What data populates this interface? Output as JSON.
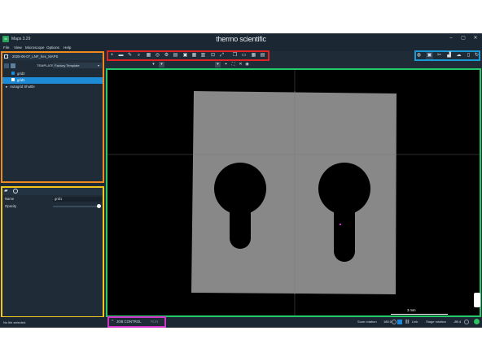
{
  "window": {
    "app_icon": "app-logo-icon",
    "title": "Maps 3.29",
    "brand": "thermo scientific",
    "controls": [
      "minimize-icon",
      "maximize-icon",
      "close-icon"
    ]
  },
  "menu": [
    "File",
    "View",
    "Microscope",
    "Options",
    "Help"
  ],
  "project_panel": {
    "document_title": "2025-06-07_LNF_hex_MAPS",
    "template_label": "TEMPLATE",
    "template_value": "Factory Template",
    "tree": [
      {
        "label": "grid2",
        "selected": false
      },
      {
        "label": "grid1",
        "selected": true
      },
      {
        "label": "Autogrid Shuttle",
        "selected": false
      }
    ]
  },
  "properties_panel": {
    "name_label": "Name",
    "name_value": "grid1",
    "opacity_label": "Opacity",
    "opacity": 1.0
  },
  "toolbar_icons": [
    "add-icon",
    "minus-icon",
    "draw-icon",
    "zoom-icon",
    "grid-icon",
    "target-icon",
    "settings-icon",
    "layers-icon",
    "image-icon",
    "tile-icon",
    "align-icon",
    "fit-icon",
    "expand-icon",
    "copy-icon",
    "paste-icon",
    "view-icon",
    "more-icon"
  ],
  "right_toolbar_icons": [
    "globe-icon",
    "camera-icon",
    "tools-icon",
    "chart-icon",
    "cloud-icon",
    "document-icon",
    "refresh-icon"
  ],
  "viewport": {
    "scalebar_label": "3 mm"
  },
  "status": {
    "selection_text": "No tile selected",
    "job_control_label": "JOB CONTROL",
    "run_label": "RUN",
    "scan_rotation_label": "Scan rotation",
    "scan_rotation_value": "180.0",
    "link_label": "Link",
    "stage_rotation_label": "Stage rotation",
    "stage_rotation_value": "-89.4"
  }
}
